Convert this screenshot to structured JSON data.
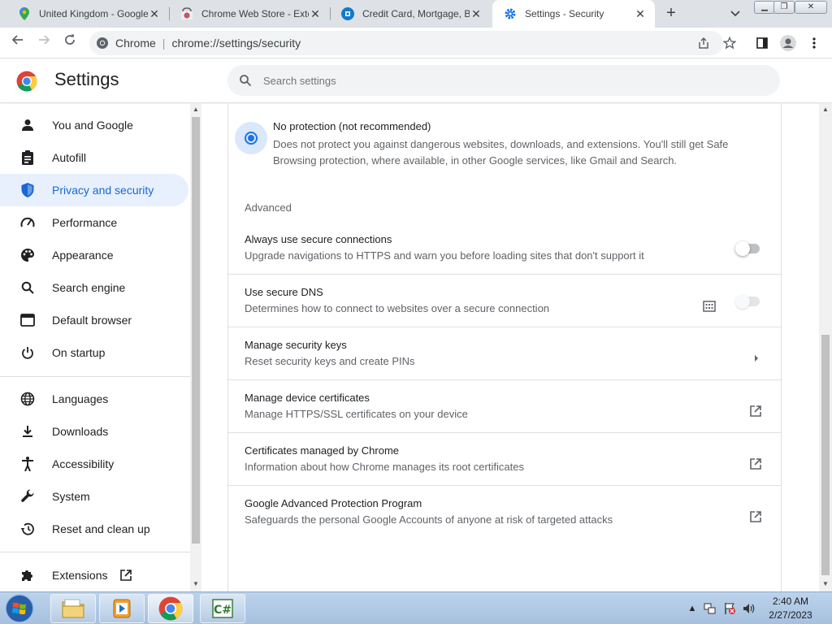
{
  "tabs": [
    {
      "title": "United Kingdom - Google",
      "icon": "maps-pin-icon"
    },
    {
      "title": "Chrome Web Store - Exte",
      "icon": "webstore-icon"
    },
    {
      "title": "Credit Card, Mortgage, B",
      "icon": "bank-icon"
    },
    {
      "title": "Settings - Security",
      "icon": "gear-icon",
      "active": true
    }
  ],
  "toolbar": {
    "chip": "Chrome",
    "url": "chrome://settings/security"
  },
  "header": {
    "title": "Settings",
    "search_placeholder": "Search settings"
  },
  "sidebar": {
    "items": [
      {
        "label": "You and Google",
        "icon": "person-icon"
      },
      {
        "label": "Autofill",
        "icon": "clipboard-icon"
      },
      {
        "label": "Privacy and security",
        "icon": "shield-icon",
        "active": true
      },
      {
        "label": "Performance",
        "icon": "speedometer-icon"
      },
      {
        "label": "Appearance",
        "icon": "palette-icon"
      },
      {
        "label": "Search engine",
        "icon": "search-icon"
      },
      {
        "label": "Default browser",
        "icon": "browser-icon"
      },
      {
        "label": "On startup",
        "icon": "power-icon"
      },
      {
        "label": "Languages",
        "icon": "globe-icon"
      },
      {
        "label": "Downloads",
        "icon": "download-icon"
      },
      {
        "label": "Accessibility",
        "icon": "accessibility-icon"
      },
      {
        "label": "System",
        "icon": "wrench-icon"
      },
      {
        "label": "Reset and clean up",
        "icon": "history-icon"
      },
      {
        "label": "Extensions",
        "icon": "puzzle-icon"
      }
    ]
  },
  "protection": {
    "title": "No protection (not recommended)",
    "description": "Does not protect you against dangerous websites, downloads, and extensions. You'll still get Safe Browsing protection, where available, in other Google services, like Gmail and Search.",
    "selected": true
  },
  "advanced": {
    "heading": "Advanced",
    "rows": [
      {
        "title": "Always use secure connections",
        "description": "Upgrade navigations to HTTPS and warn you before loading sites that don't support it",
        "control": "toggle",
        "on": false
      },
      {
        "title": "Use secure DNS",
        "description": "Determines how to connect to websites over a secure connection",
        "control": "toggle-disabled",
        "on": false,
        "policy_icon": "enterprise-building-icon"
      },
      {
        "title": "Manage security keys",
        "description": "Reset security keys and create PINs",
        "control": "arrow"
      },
      {
        "title": "Manage device certificates",
        "description": "Manage HTTPS/SSL certificates on your device",
        "control": "external"
      },
      {
        "title": "Certificates managed by Chrome",
        "description": "Information about how Chrome manages its root certificates",
        "control": "external"
      },
      {
        "title": "Google Advanced Protection Program",
        "description": "Safeguards the personal Google Accounts of anyone at risk of targeted attacks",
        "control": "external"
      }
    ]
  },
  "taskbar": {
    "time": "2:40 AM",
    "date": "2/27/2023"
  },
  "colors": {
    "accent": "#1a73e8",
    "active_nav_bg": "#e8f0fe",
    "active_nav_text": "#1967d2"
  }
}
